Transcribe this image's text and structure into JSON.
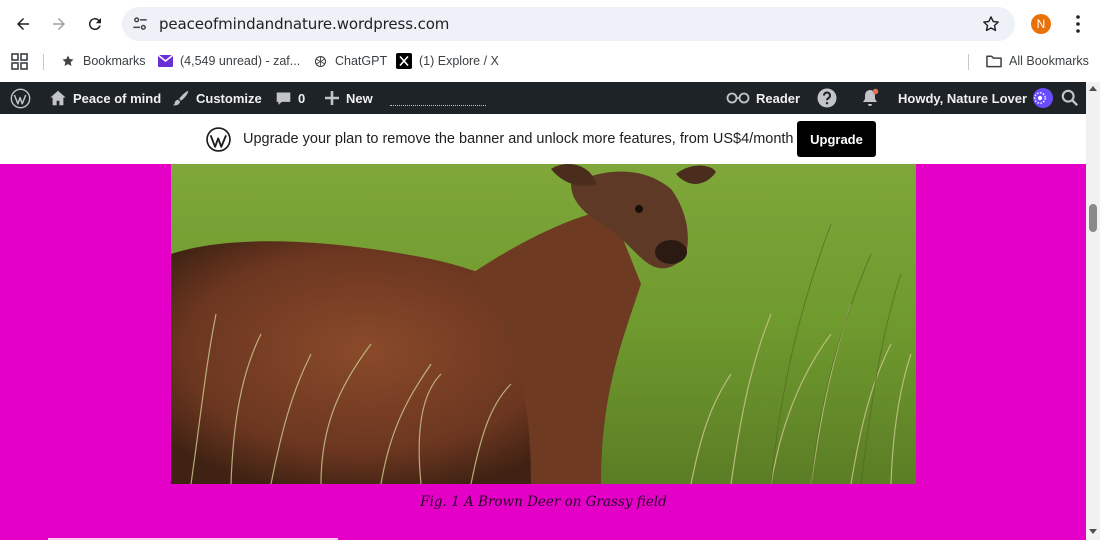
{
  "browser": {
    "url": "peaceofmindandnature.wordpress.com",
    "profile_initial": "N",
    "icons": {
      "back": "arrow-left-icon",
      "forward": "arrow-right-icon",
      "reload": "reload-icon",
      "site_info": "tune-icon",
      "bookmark": "star-outline-icon",
      "menu": "kebab-icon"
    }
  },
  "bookmarks_bar": {
    "items": [
      {
        "label": "Bookmarks",
        "icon": "star-icon"
      },
      {
        "label": "(4,549 unread) - zaf...",
        "icon": "mail-icon"
      },
      {
        "label": "ChatGPT",
        "icon": "chatgpt-icon"
      },
      {
        "label": "(1) Explore / X",
        "icon": "x-icon"
      }
    ],
    "all_bookmarks": "All Bookmarks"
  },
  "admin_bar": {
    "site_name": "Peace of mind",
    "customize": "Customize",
    "comments_count": "0",
    "new": "New",
    "reader": "Reader",
    "howdy": "Howdy, Nature Lover"
  },
  "banner": {
    "text": "Upgrade your plan to remove the banner and unlock more features, from US$4/month",
    "button": "Upgrade"
  },
  "content": {
    "caption": "Fig. 1 A Brown Deer on Grassy field",
    "page_background": "#e400c6"
  }
}
